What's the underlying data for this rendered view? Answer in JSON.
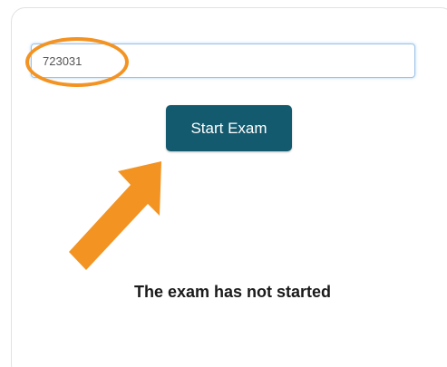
{
  "exam": {
    "code_value": "723031",
    "start_button_label": "Start Exam",
    "status_message": "The exam has not started"
  },
  "annotations": {
    "highlight_color": "#f39322",
    "arrow_color": "#f39322",
    "arrow_icon": "arrow-up-right-icon"
  },
  "colors": {
    "button_background": "#145a6e",
    "button_text": "#ffffff"
  }
}
